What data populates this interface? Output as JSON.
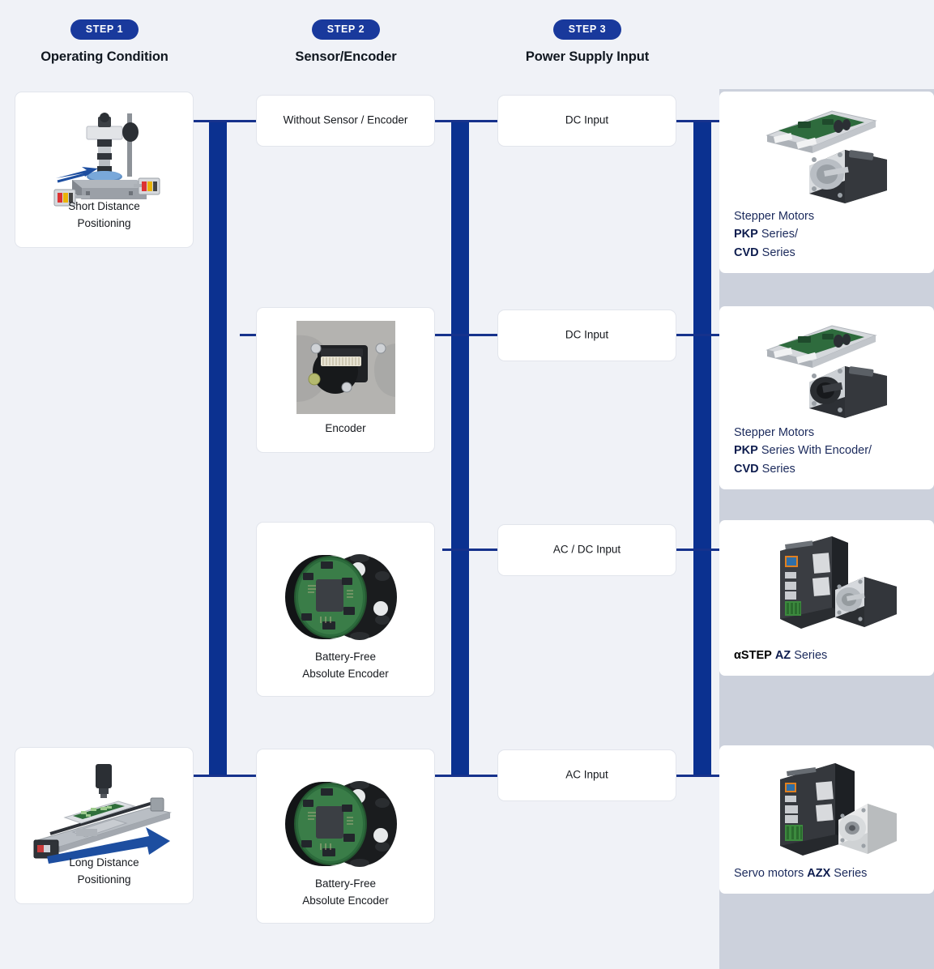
{
  "header": {
    "steps": [
      {
        "pill": "STEP 1",
        "title": "Operating Condition"
      },
      {
        "pill": "STEP 2",
        "title": "Sensor/Encoder"
      },
      {
        "pill": "STEP 3",
        "title": "Power Supply Input"
      }
    ]
  },
  "operating_conditions": [
    {
      "label_line1": "Short Distance",
      "label_line2": "Positioning",
      "image": "xy-stage-microscope-photo"
    },
    {
      "label_line1": "Long Distance",
      "label_line2": "Positioning",
      "image": "linear-slide-actuator-photo"
    }
  ],
  "sensors": [
    {
      "label_line1": "Without Sensor / Encoder",
      "label_line2": "",
      "image": ""
    },
    {
      "label_line1": "Encoder",
      "label_line2": "",
      "image": "encoder-module-photo"
    },
    {
      "label_line1": "Battery-Free",
      "label_line2": "Absolute Encoder",
      "image": "battery-free-absolute-encoder-photo"
    },
    {
      "label_line1": "Battery-Free",
      "label_line2": "Absolute Encoder",
      "image": "battery-free-absolute-encoder-photo"
    }
  ],
  "power_inputs": [
    {
      "label": "DC Input"
    },
    {
      "label": "DC Input"
    },
    {
      "label": "AC / DC Input"
    },
    {
      "label": "AC Input"
    }
  ],
  "products": [
    {
      "image": "stepper-motor-with-driver-board-photo",
      "line1_plain": "Stepper Motors",
      "line2_bold": "PKP",
      "line2_plain": " Series/",
      "line3_bold": "CVD",
      "line3_plain": " Series"
    },
    {
      "image": "stepper-motor-with-encoder-and-driver-board-photo",
      "line1_plain": "Stepper Motors",
      "line2_bold": "PKP",
      "line2_plain": " Series With Encoder/",
      "line3_bold": "CVD",
      "line3_plain": " Series"
    },
    {
      "image": "astep-az-driver-and-motor-photo",
      "line1_black_bold": "αSTEP",
      "line1_bold": "AZ",
      "line1_plain": " Series"
    },
    {
      "image": "azx-servo-driver-and-motor-photo",
      "line1_plain": "Servo motors ",
      "line1_bold": "AZX",
      "line1_plain2": " Series"
    }
  ],
  "colors": {
    "brand_blue": "#0b3190",
    "pill_blue": "#19399c",
    "link_blue": "#16328c",
    "page_bg": "#f0f2f7",
    "band_gray": "#ccd1dc",
    "product_text": "#1b2a5c"
  }
}
